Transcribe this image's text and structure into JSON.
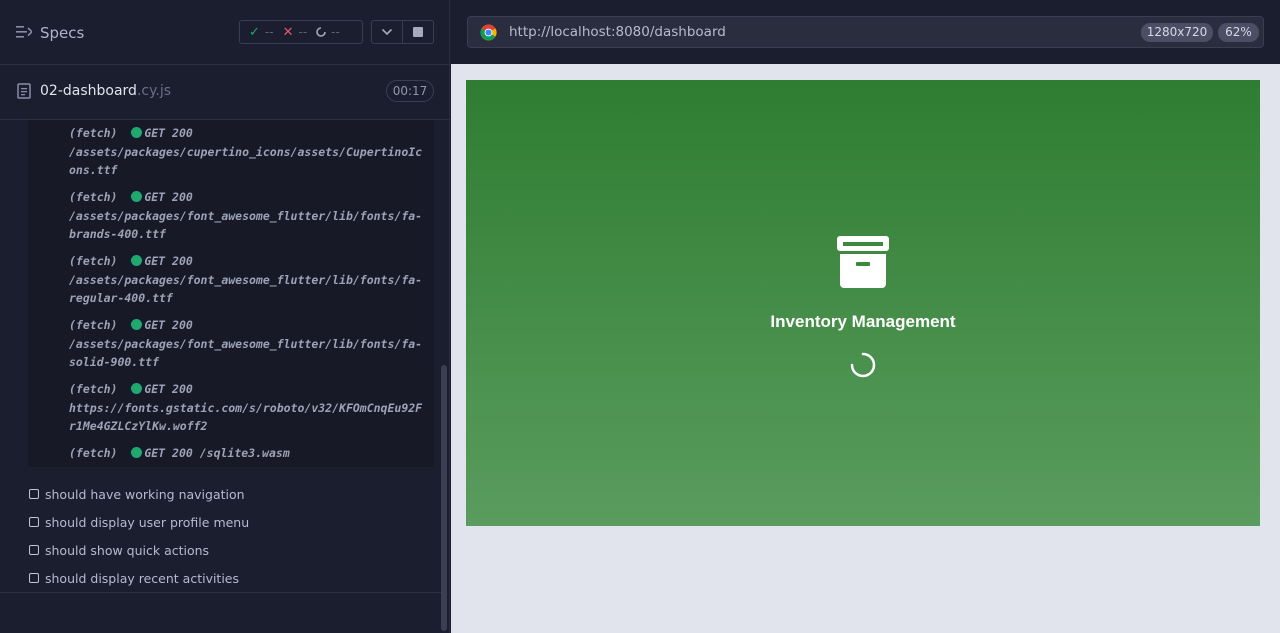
{
  "runner": {
    "specs_title": "Specs",
    "stats": {
      "passed": "--",
      "failed": "--",
      "pending": "--"
    },
    "spec_file": {
      "name": "02-dashboard",
      "ext": ".cy.js",
      "duration": "00:17"
    }
  },
  "log": [
    {
      "tag": "(fetch)",
      "status": "GET 200",
      "path": "/assets/packages/cupertino_icons/assets/CupertinoIcons.ttf"
    },
    {
      "tag": "(fetch)",
      "status": "GET 200",
      "path": "/assets/packages/font_awesome_flutter/lib/fonts/fa-brands-400.ttf"
    },
    {
      "tag": "(fetch)",
      "status": "GET 200",
      "path": "/assets/packages/font_awesome_flutter/lib/fonts/fa-regular-400.ttf"
    },
    {
      "tag": "(fetch)",
      "status": "GET 200",
      "path": "/assets/packages/font_awesome_flutter/lib/fonts/fa-solid-900.ttf"
    },
    {
      "tag": "(fetch)",
      "status": "GET 200",
      "path": "https://fonts.gstatic.com/s/roboto/v32/KFOmCnqEu92Fr1Me4GZLCzYlKw.woff2"
    },
    {
      "tag": "(fetch)",
      "status": "GET 200",
      "path": "/sqlite3.wasm"
    }
  ],
  "tests": [
    "should have working navigation",
    "should display user profile menu",
    "should show quick actions",
    "should display recent activities"
  ],
  "browser": {
    "url": "http://localhost:8080/dashboard",
    "viewport_size": "1280x720",
    "zoom": "62%"
  },
  "app": {
    "title": "Inventory Management",
    "icon": "archive-box-icon",
    "colors": {
      "gradient_top": "#2e7d32",
      "gradient_bottom": "#5a9c5e",
      "success": "#1fa971",
      "failure": "#e45770"
    }
  }
}
